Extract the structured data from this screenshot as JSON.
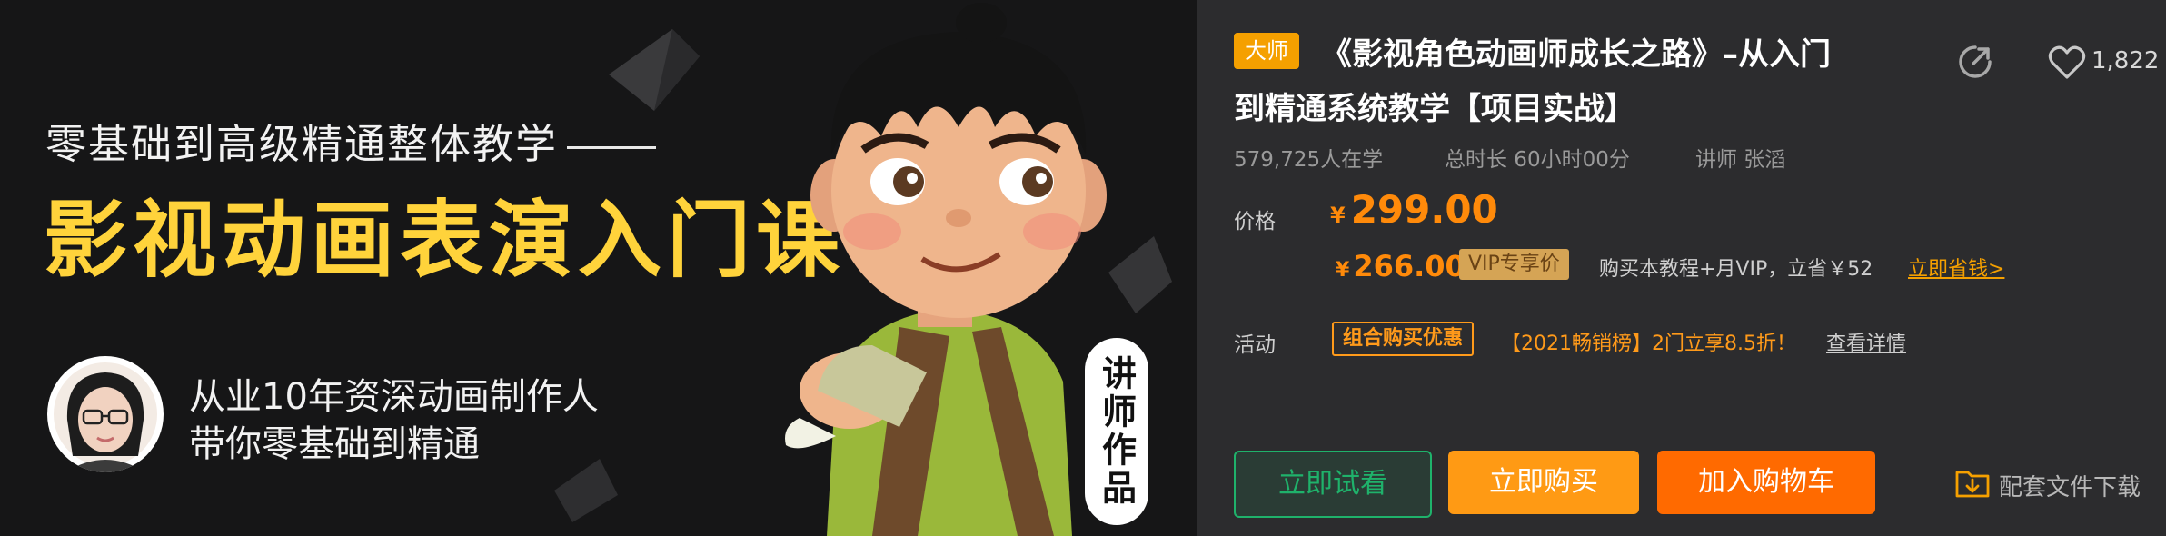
{
  "banner": {
    "tagline": "零基础到高级精通整体教学",
    "headline": "影视动画表演入门课",
    "experience_line1": "从业10年资深动画制作人",
    "experience_line2": "带你零基础到精通",
    "instructor_badge": "讲师作品"
  },
  "course": {
    "tag": "大师",
    "title_line1": "《影视角色动画师成长之路》–从入门",
    "title_line2": "到精通系统教学【项目实战】",
    "likes": "1,822",
    "students": "579,725人在学",
    "duration": "总时长 60小时00分",
    "instructor": "讲师 张滔"
  },
  "price": {
    "label": "价格",
    "currency": "¥",
    "amount": "299.00",
    "vip_amount": "266.00",
    "vip_tag": "VIP专享价",
    "vip_note": "购买本教程+月VIP，立省￥52",
    "save_link": "立即省钱>"
  },
  "activity": {
    "label": "活动",
    "tag": "组合购买优惠",
    "promo": "【2021畅销榜】2门立享8.5折！",
    "detail_link": "查看详情"
  },
  "actions": {
    "trial": "立即试看",
    "buy": "立即购买",
    "cart": "加入购物车",
    "download": "配套文件下载"
  },
  "icons": {
    "share": "share-icon",
    "like": "heart-icon",
    "download": "download-folder-icon"
  },
  "colors": {
    "accent_orange": "#ff9a14",
    "cart_orange": "#ff6a00",
    "trial_green": "#1fb26b",
    "headline_yellow": "#ffd33b"
  }
}
